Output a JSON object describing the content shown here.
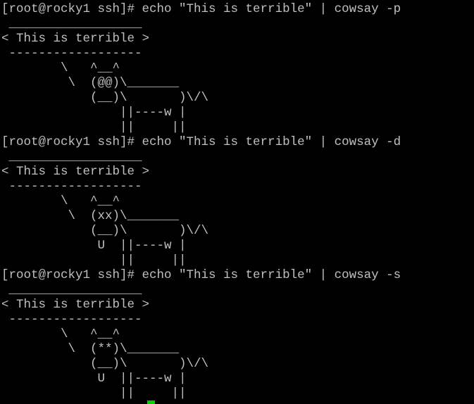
{
  "terminal": {
    "lines": [
      "[root@rocky1 ssh]# echo \"This is terrible\" | cowsay -p",
      " __________________",
      "< This is terrible >",
      " ------------------",
      "        \\   ^__^",
      "         \\  (@@)\\_______",
      "            (__)\\       )\\/\\",
      "                ||----w |",
      "                ||     ||",
      "[root@rocky1 ssh]# echo \"This is terrible\" | cowsay -d",
      " __________________",
      "< This is terrible >",
      " ------------------",
      "        \\   ^__^",
      "         \\  (xx)\\_______",
      "            (__)\\       )\\/\\",
      "             U  ||----w |",
      "                ||     ||",
      "[root@rocky1 ssh]# echo \"This is terrible\" | cowsay -s",
      " __________________",
      "< This is terrible >",
      " ------------------",
      "        \\   ^__^",
      "         \\  (**)\\_______",
      "            (__)\\       )\\/\\",
      "             U  ||----w |",
      "                ||     ||"
    ],
    "colors": {
      "background": "#000000",
      "foreground": "#c0c0c0",
      "cursor": "#00d200"
    }
  }
}
